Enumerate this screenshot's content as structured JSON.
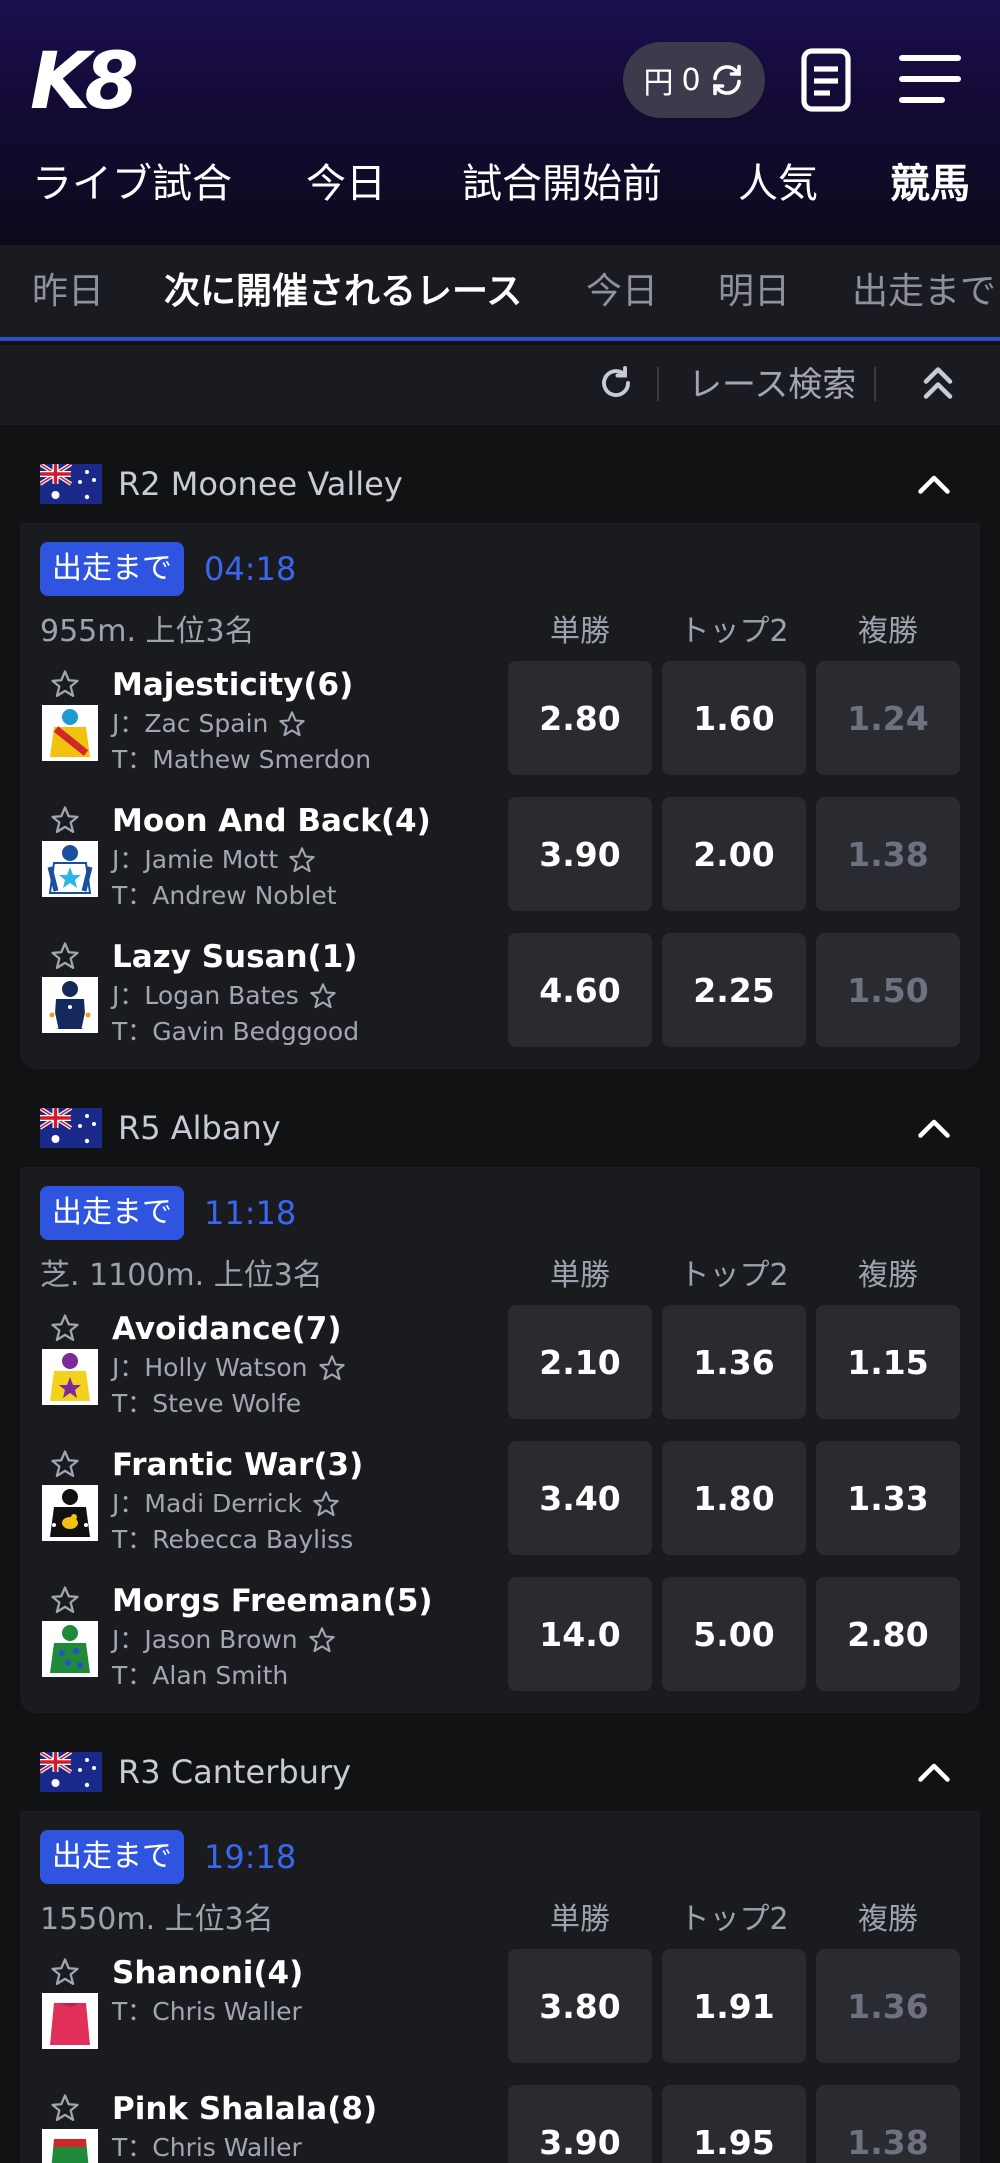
{
  "header": {
    "logo": "K8",
    "balance": {
      "currency": "円",
      "amount": "0"
    }
  },
  "sports_tabs": [
    {
      "label": "ライブ試合",
      "active": false
    },
    {
      "label": "今日",
      "active": false
    },
    {
      "label": "試合開始前",
      "active": false
    },
    {
      "label": "人気",
      "active": false
    },
    {
      "label": "競馬",
      "active": true
    }
  ],
  "sub_tabs": [
    {
      "label": "昨日",
      "active": false
    },
    {
      "label": "次に開催されるレース",
      "active": true
    },
    {
      "label": "今日",
      "active": false
    },
    {
      "label": "明日",
      "active": false
    },
    {
      "label": "出走まで",
      "active": false
    }
  ],
  "toolbar": {
    "search_label": "レース検索"
  },
  "columns": [
    "単勝",
    "トップ2",
    "複勝"
  ],
  "countdown_label": "出走まで",
  "races": [
    {
      "name": "R2 Moonee Valley",
      "countdown": "04:18",
      "info": "955m. 上位3名",
      "runners": [
        {
          "name": "Majesticity(6)",
          "jockey": "J：Zac Spain",
          "trainer": "T：Mathew Smerdon",
          "odds": [
            "2.80",
            "1.60",
            "1.24"
          ],
          "place_muted": true
        },
        {
          "name": "Moon And Back(4)",
          "jockey": "J：Jamie Mott",
          "trainer": "T：Andrew Noblet",
          "odds": [
            "3.90",
            "2.00",
            "1.38"
          ],
          "place_muted": true
        },
        {
          "name": "Lazy Susan(1)",
          "jockey": "J：Logan Bates",
          "trainer": "T：Gavin Bedggood",
          "odds": [
            "4.60",
            "2.25",
            "1.50"
          ],
          "place_muted": true
        }
      ]
    },
    {
      "name": "R5 Albany",
      "countdown": "11:18",
      "info": "芝. 1100m. 上位3名",
      "runners": [
        {
          "name": "Avoidance(7)",
          "jockey": "J：Holly Watson",
          "trainer": "T：Steve Wolfe",
          "odds": [
            "2.10",
            "1.36",
            "1.15"
          ],
          "place_muted": false
        },
        {
          "name": "Frantic War(3)",
          "jockey": "J：Madi Derrick",
          "trainer": "T：Rebecca Bayliss",
          "odds": [
            "3.40",
            "1.80",
            "1.33"
          ],
          "place_muted": false
        },
        {
          "name": "Morgs Freeman(5)",
          "jockey": "J：Jason Brown",
          "trainer": "T：Alan Smith",
          "odds": [
            "14.0",
            "5.00",
            "2.80"
          ],
          "place_muted": false
        }
      ]
    },
    {
      "name": "R3 Canterbury",
      "countdown": "19:18",
      "info": "1550m. 上位3名",
      "runners": [
        {
          "name": "Shanoni(4)",
          "trainer": "T：Chris Waller",
          "odds": [
            "3.80",
            "1.91",
            "1.36"
          ],
          "place_muted": true
        },
        {
          "name": "Pink Shalala(8)",
          "trainer": "T：Chris Waller",
          "odds": [
            "3.90",
            "1.95",
            "1.38"
          ],
          "place_muted": true
        }
      ]
    }
  ],
  "colors": {
    "accent": "#2f54e0",
    "countdown": "#3a67f0",
    "card": "#1a1b1f",
    "odds_box": "#2a2b31"
  },
  "icons": [
    "refresh-icon",
    "bet-slip-icon",
    "menu-icon",
    "reload-icon",
    "collapse-all-icon",
    "australia-flag-icon",
    "chevron-up-icon",
    "star-icon",
    "jockey-silk-icon"
  ]
}
